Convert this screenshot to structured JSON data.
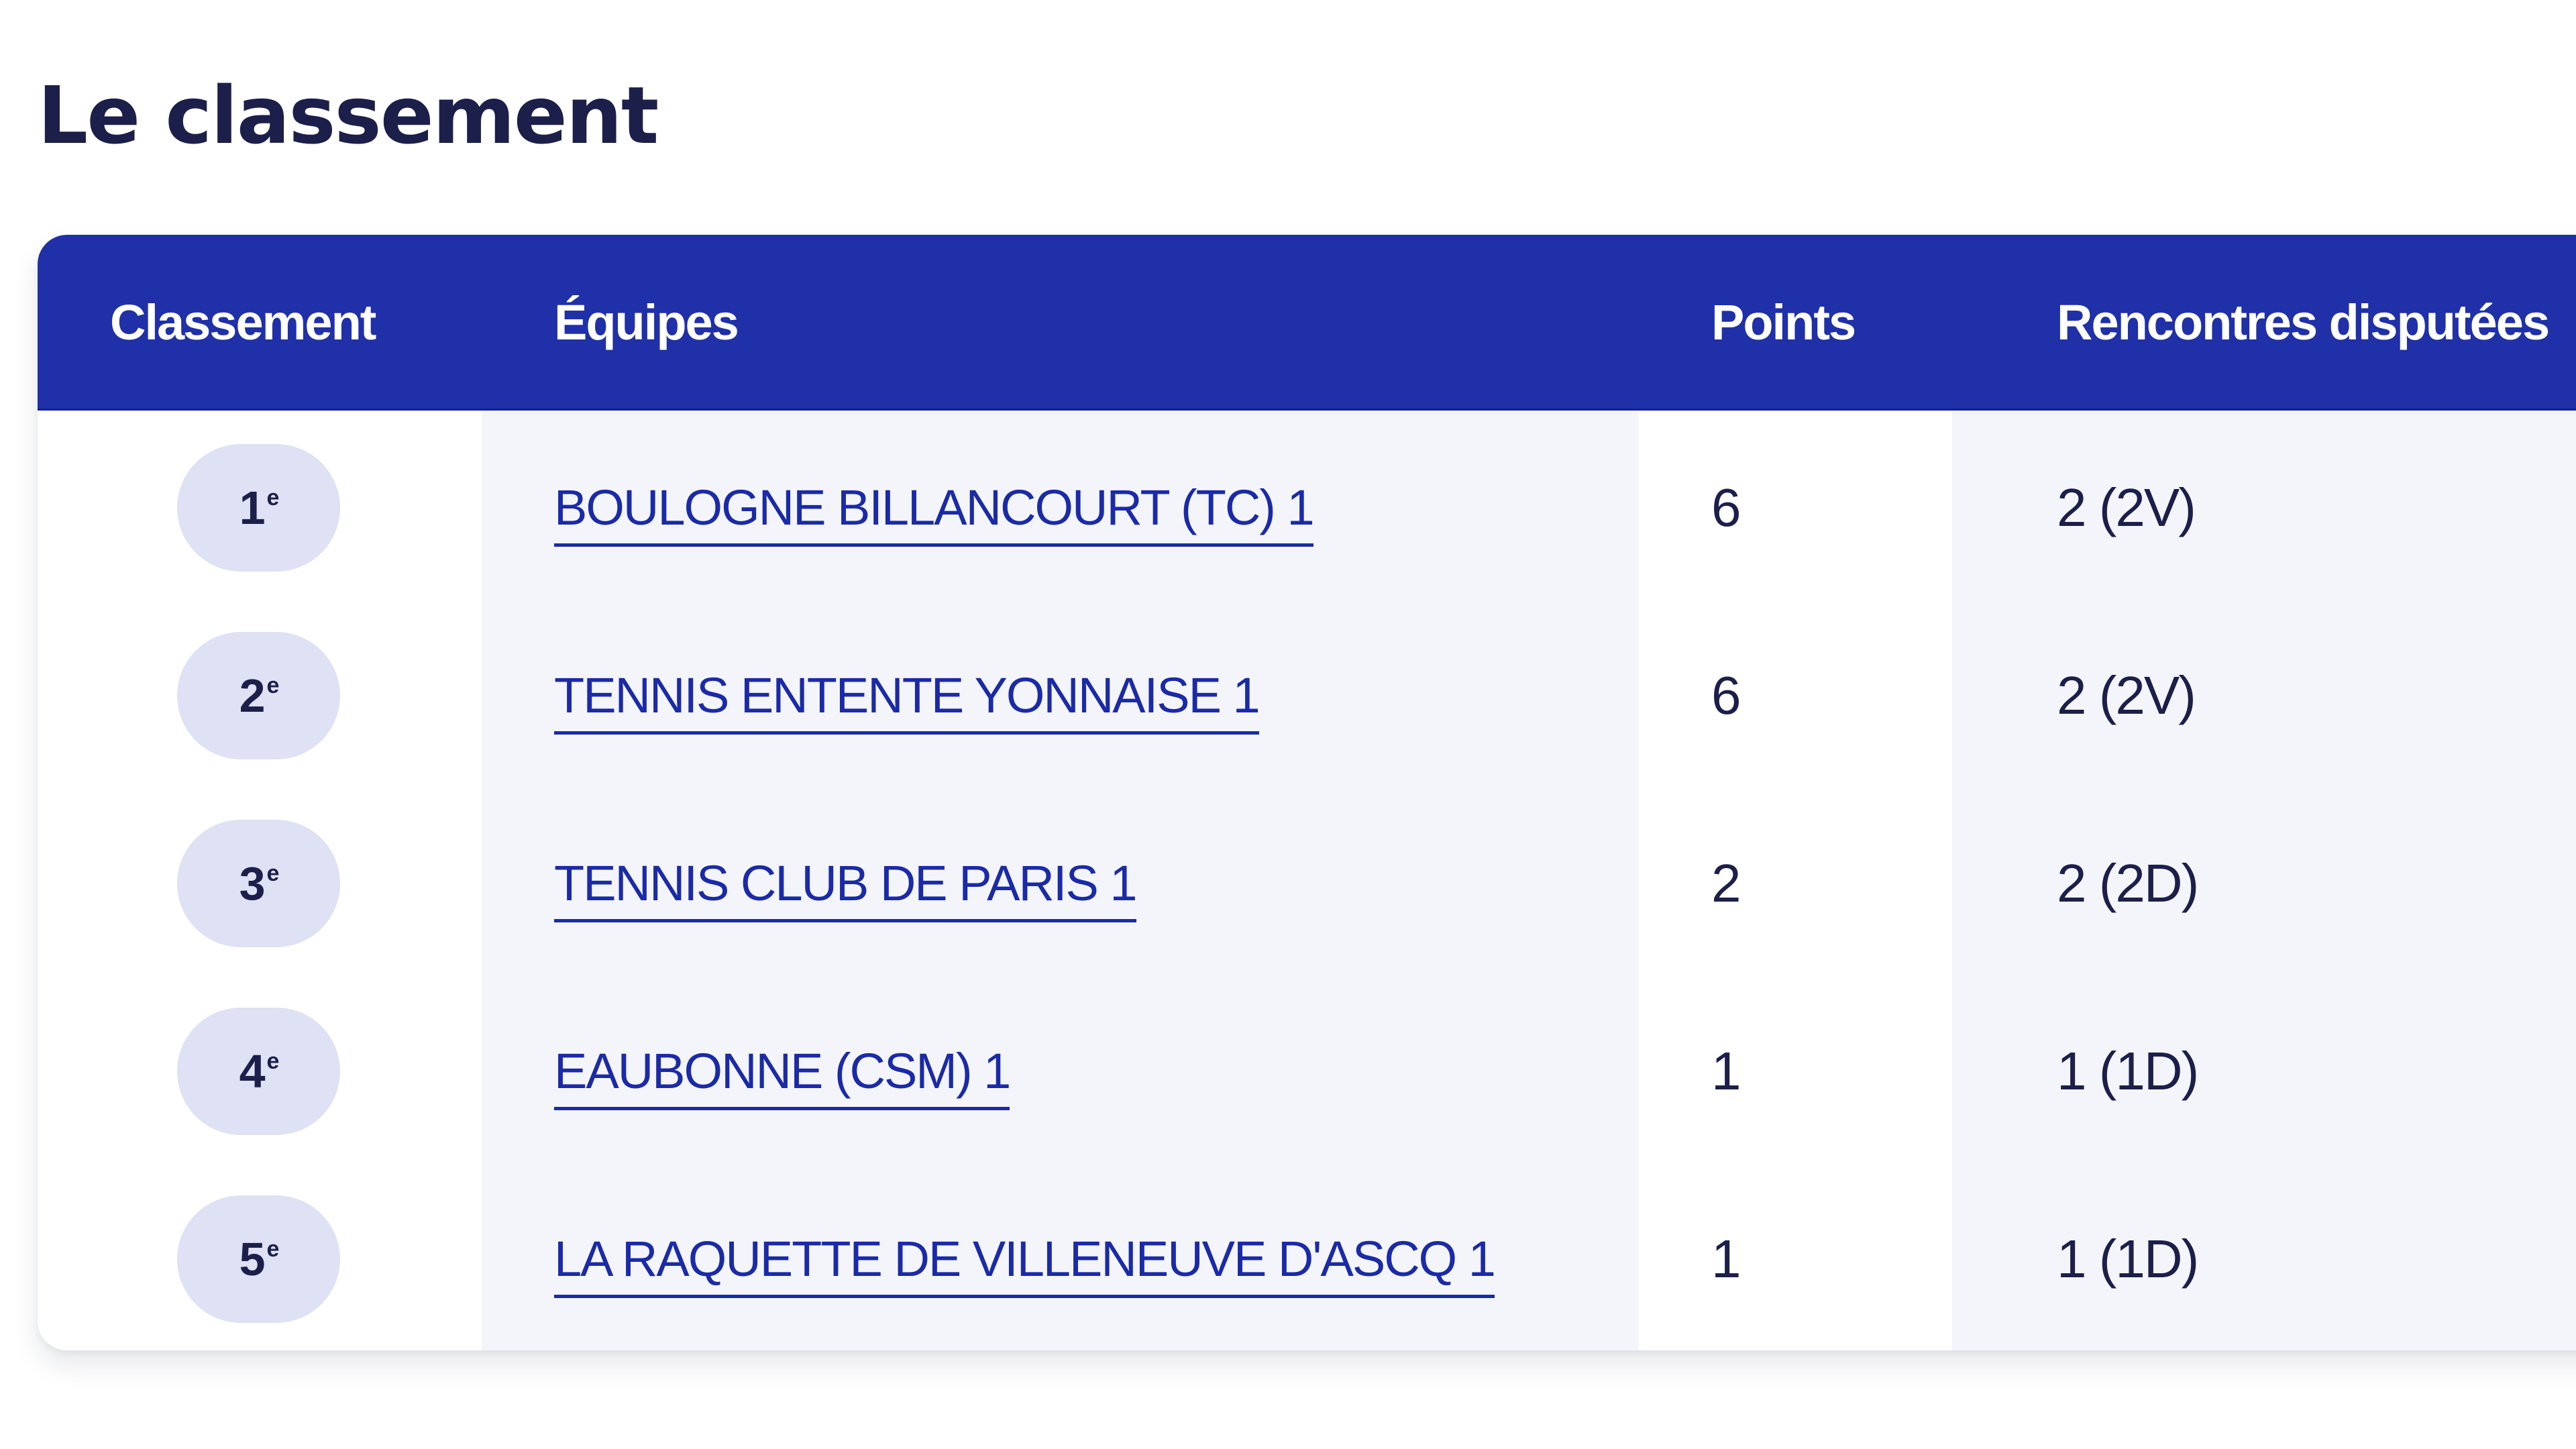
{
  "page": {
    "title": "Le classement"
  },
  "table": {
    "headers": {
      "rank": "Classement",
      "team": "Équipes",
      "points": "Points",
      "games": "Rencontres disputées"
    },
    "rows": [
      {
        "rank": "1",
        "rank_suffix": "e",
        "team": "BOULOGNE BILLANCOURT (TC) 1",
        "points": "6",
        "games": "2 (2V)"
      },
      {
        "rank": "2",
        "rank_suffix": "e",
        "team": "TENNIS ENTENTE YONNAISE 1",
        "points": "6",
        "games": "2 (2V)"
      },
      {
        "rank": "3",
        "rank_suffix": "e",
        "team": "TENNIS CLUB DE PARIS 1",
        "points": "2",
        "games": "2 (2D)"
      },
      {
        "rank": "4",
        "rank_suffix": "e",
        "team": "EAUBONNE (CSM) 1",
        "points": "1",
        "games": "1 (1D)"
      },
      {
        "rank": "5",
        "rank_suffix": "e",
        "team": "LA RAQUETTE DE VILLENEUVE D'ASCQ 1",
        "points": "1",
        "games": "1 (1D)"
      }
    ]
  },
  "colors": {
    "header_bg": "#1f30a8",
    "title_text": "#1c1f4a",
    "link": "#1a2aa8",
    "rank_pill_bg": "#dfe1f4",
    "alt_column_bg": "#f4f5fa"
  }
}
